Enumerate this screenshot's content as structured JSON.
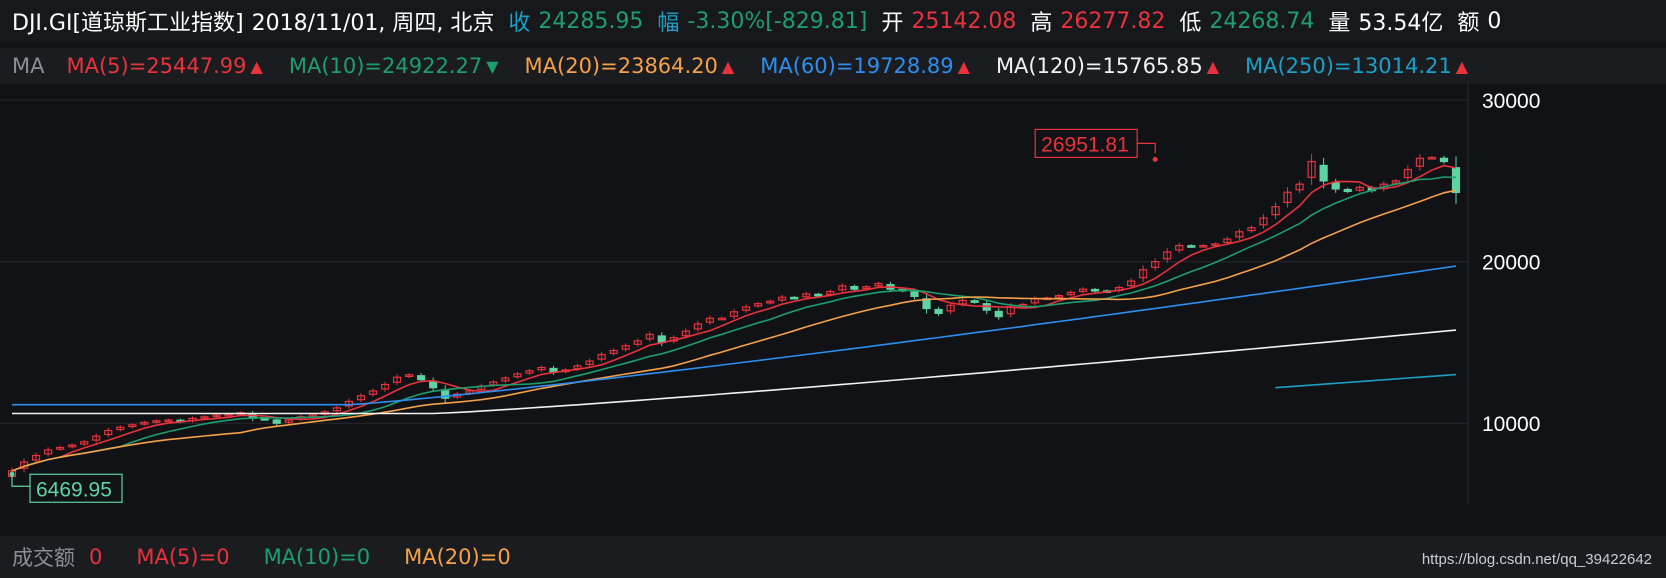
{
  "header": {
    "symbol": "DJI.GI[道琼斯工业指数]",
    "date": "2018/11/01, 周四, 北京",
    "close_label": "收",
    "close_value": "24285.95",
    "change_label": "幅",
    "change_pct": "-3.30%",
    "change_abs": "[-829.81]",
    "open_label": "开",
    "open_value": "25142.08",
    "high_label": "高",
    "high_value": "26277.82",
    "low_label": "低",
    "low_value": "24268.74",
    "volume_label": "量",
    "volume_value": "53.54亿",
    "amount_label": "额",
    "amount_value": "0"
  },
  "ma_bar": {
    "label": "MA",
    "items": [
      {
        "text": "MA(5)=25447.99",
        "color": "#e8323c",
        "dir": "up"
      },
      {
        "text": "MA(10)=24922.27",
        "color": "#1e9e6e",
        "dir": "down"
      },
      {
        "text": "MA(20)=23864.20",
        "color": "#f5a14a",
        "dir": "up"
      },
      {
        "text": "MA(60)=19728.89",
        "color": "#2d8ef0",
        "dir": "up"
      },
      {
        "text": "MA(120)=15765.85",
        "color": "#f2f2f2",
        "dir": "up"
      },
      {
        "text": "MA(250)=13014.21",
        "color": "#1ba0c8",
        "dir": "up"
      }
    ]
  },
  "volume_bar": {
    "label": "成交额",
    "value": "0",
    "items": [
      {
        "text": "MA(5)=0",
        "color": "#e8323c"
      },
      {
        "text": "MA(10)=0",
        "color": "#1e9e6e"
      },
      {
        "text": "MA(20)=0",
        "color": "#f5a14a"
      }
    ]
  },
  "watermark": "https://blog.csdn.net/qq_39422642",
  "colors": {
    "up": "#e8323c",
    "down": "#5fd3a2",
    "text": "#ffffff",
    "muted": "#8a8e95",
    "label_cyan": "#1ba0c8",
    "grid": "#26292e"
  },
  "chart_data": {
    "type": "candlestick",
    "y_ticks": [
      "30000",
      "20000",
      "10000"
    ],
    "y_tick_values": [
      30000,
      20000,
      10000
    ],
    "ylim": [
      5000,
      31000
    ],
    "max_marker": {
      "index": 95,
      "value": 26951.81,
      "label": "26951.81"
    },
    "min_marker": {
      "index": 0,
      "value": 6469.95,
      "label": "6469.95"
    },
    "closes": [
      7050,
      7600,
      8000,
      8350,
      8500,
      8650,
      8850,
      9200,
      9550,
      9750,
      9900,
      10050,
      10150,
      10200,
      10100,
      10300,
      10400,
      10500,
      10550,
      10650,
      10300,
      10250,
      10000,
      10200,
      10400,
      10500,
      10700,
      10950,
      11350,
      11700,
      12000,
      12400,
      12850,
      13000,
      12700,
      12200,
      11550,
      11800,
      12000,
      12300,
      12550,
      12800,
      13050,
      13250,
      13450,
      13150,
      13300,
      13550,
      13850,
      14250,
      14500,
      14800,
      15100,
      15500,
      15000,
      15300,
      15700,
      16150,
      16500,
      16500,
      16900,
      17200,
      17400,
      17550,
      17800,
      17750,
      18000,
      17900,
      18150,
      18500,
      18300,
      18450,
      18650,
      18300,
      18200,
      17850,
      17100,
      16800,
      17300,
      17600,
      17500,
      17000,
      16600,
      17200,
      17350,
      17700,
      17750,
      17900,
      18100,
      18300,
      18200,
      18150,
      18400,
      18800,
      19500,
      20000,
      20600,
      21000,
      20950,
      21000,
      21100,
      21400,
      21850,
      22100,
      22700,
      23400,
      24300,
      24800,
      26200,
      25000,
      24500,
      24350,
      24600,
      24400,
      24800,
      25000,
      25700,
      26400,
      26450,
      26200,
      24286
    ],
    "ma_series": [
      {
        "name": "MA(5)",
        "color": "#e8323c",
        "start": 4,
        "window": 5
      },
      {
        "name": "MA(10)",
        "color": "#1e9e6e",
        "start": 0,
        "window": 10
      },
      {
        "name": "MA(20)",
        "color": "#f5a14a",
        "start": 0,
        "window": 20
      },
      {
        "name": "MA(60)",
        "color": "#2d8ef0",
        "start": 0,
        "flat_until": 28,
        "flat_value": 11150,
        "end_value": 19729
      },
      {
        "name": "MA(120)",
        "color": "#f2f2f2",
        "start": 0,
        "flat_until": 35,
        "flat_value": 10600,
        "end_value": 15766
      },
      {
        "name": "MA(250)",
        "color": "#1ba0c8",
        "start": 105,
        "start_value": 12200,
        "end_value": 13014
      }
    ]
  }
}
